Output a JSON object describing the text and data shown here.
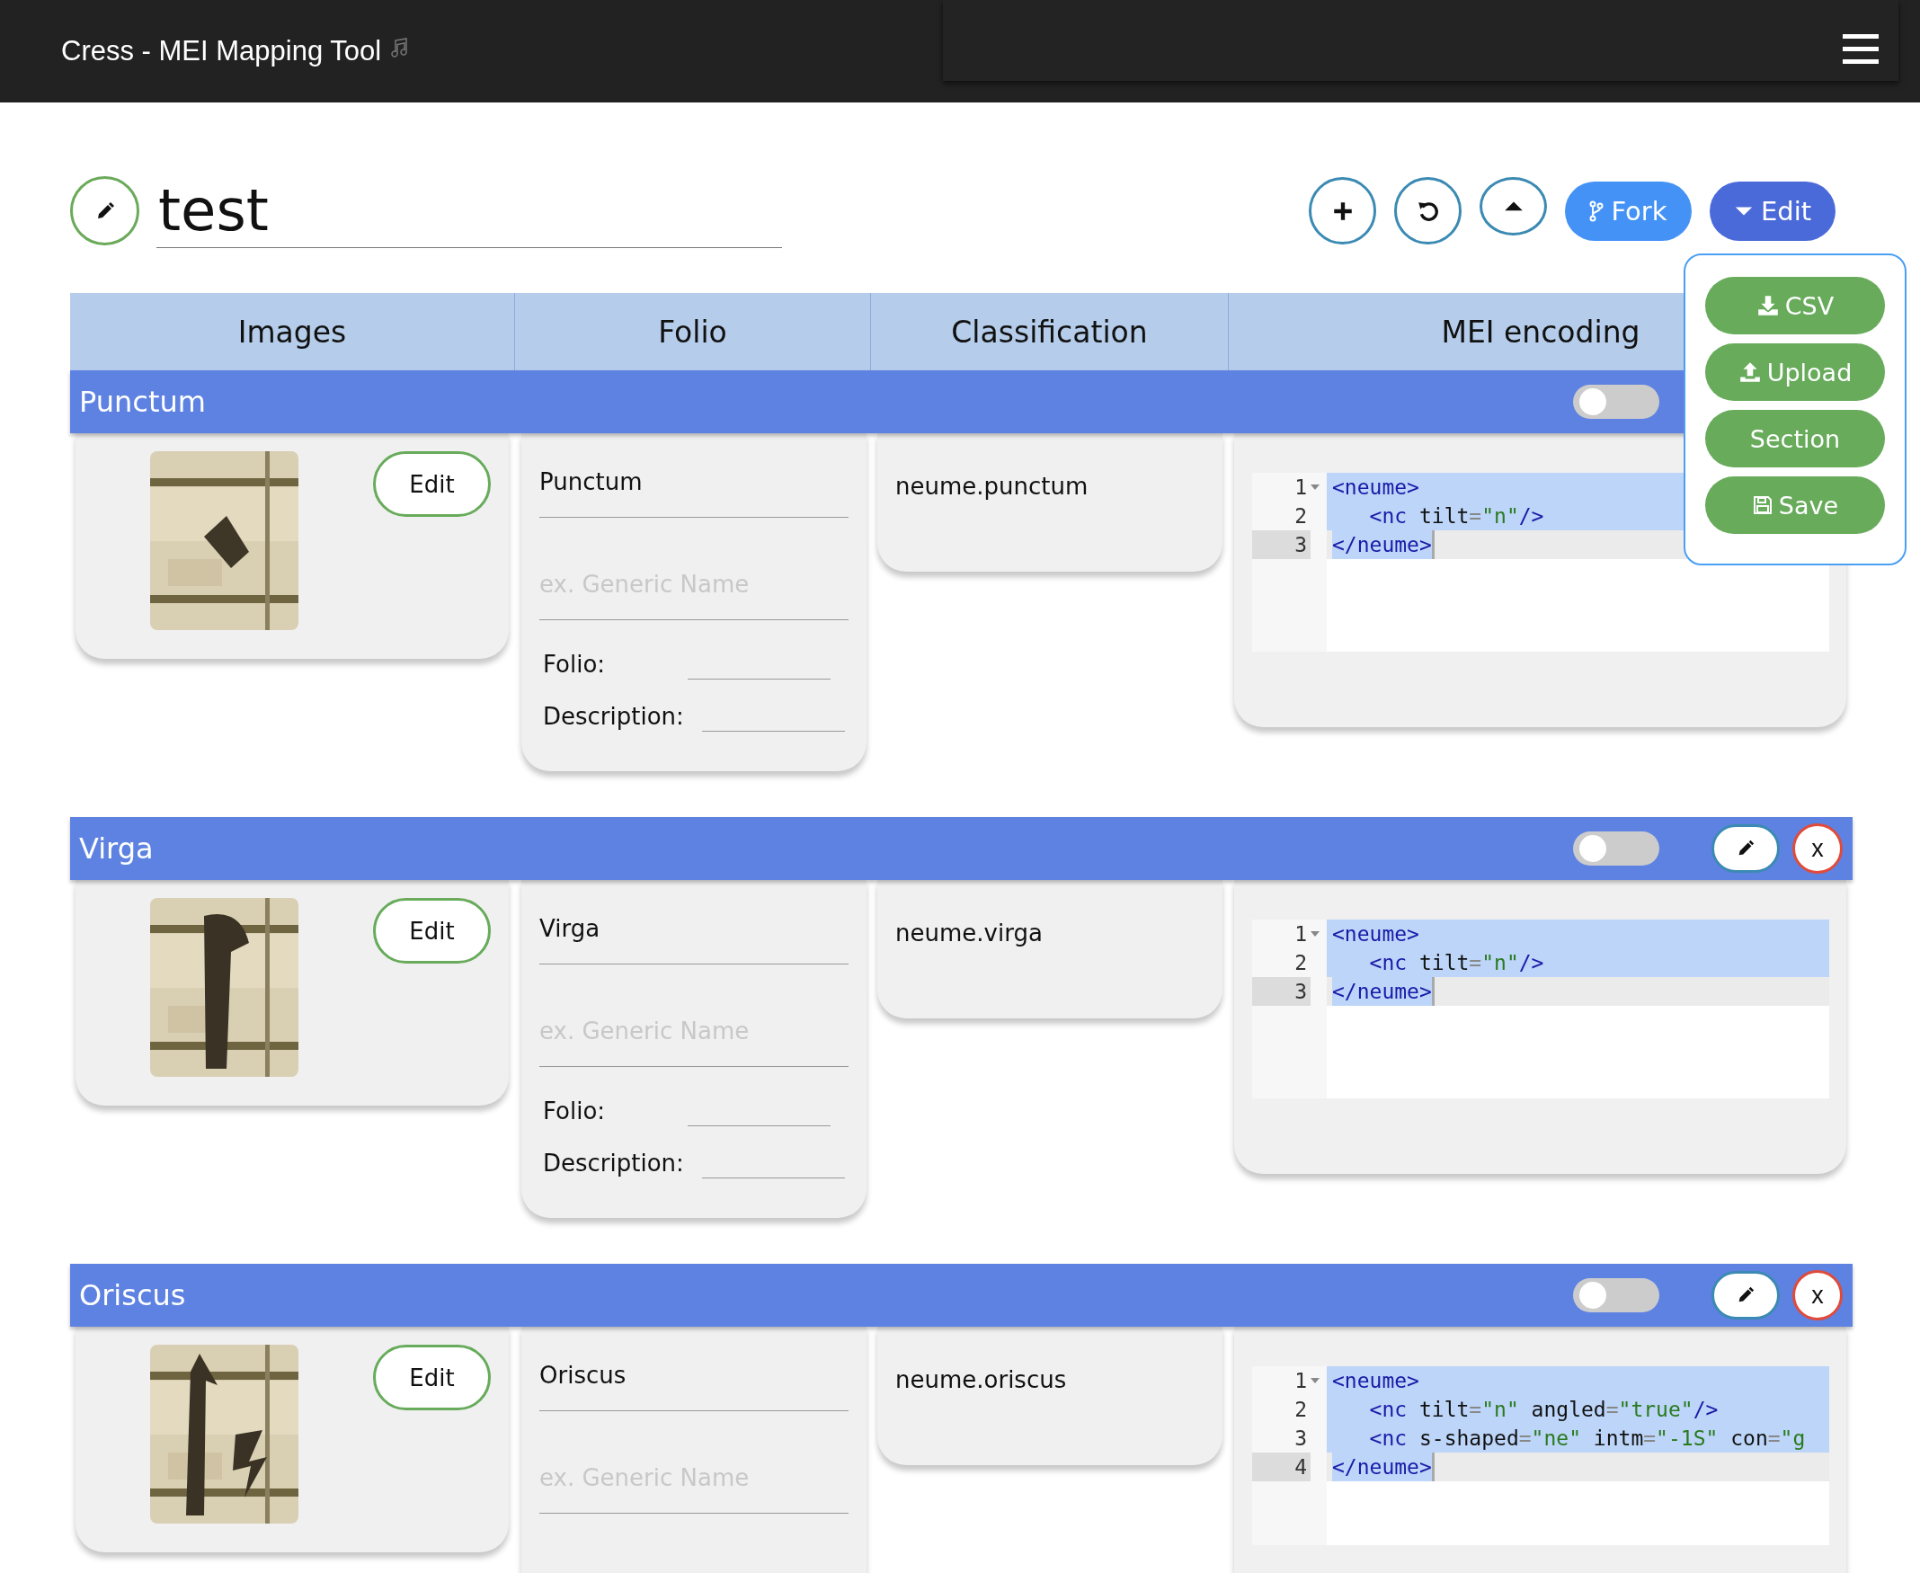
{
  "header": {
    "title": "Cress - MEI Mapping Tool"
  },
  "document": {
    "title": "test"
  },
  "toolbar": [
    {
      "kind": "add"
    },
    {
      "kind": "undo"
    },
    {
      "kind": "collapse"
    },
    {
      "kind": "fork",
      "label": "Fork"
    },
    {
      "kind": "edit",
      "label": "Edit"
    }
  ],
  "edit_menu": {
    "open": true,
    "items": [
      {
        "kind": "download",
        "label": "CSV"
      },
      {
        "kind": "upload",
        "label": "Upload"
      },
      {
        "kind": "plain",
        "label": "Section"
      },
      {
        "kind": "save",
        "label": "Save"
      }
    ]
  },
  "table": {
    "columns": [
      "Images",
      "Folio",
      "Classification",
      "MEI encoding"
    ],
    "sections": [
      {
        "title": "Punctum",
        "toggle": {
          "on": false
        },
        "image": {
          "kind": "picture"
        },
        "image_button": "Edit",
        "name": "Punctum",
        "generic_name_placeholder": "ex. Generic Name",
        "folio_label": "Folio:",
        "description_label": "Description:",
        "classification": "neume.punctum",
        "mei": [
          {
            "number": "1",
            "text": "<neume>",
            "selected": true,
            "active": false
          },
          {
            "number": "2",
            "text": "   <nc tilt=\"n\"/>",
            "selected": true,
            "active": false
          },
          {
            "number": "3",
            "text": "</neume>",
            "selected": true,
            "active": true
          }
        ]
      },
      {
        "title": "Virga",
        "toggle": {
          "on": false
        },
        "buttons": [
          {
            "kind": "edit"
          },
          {
            "kind": "delete",
            "label": "x"
          }
        ],
        "image": {
          "kind": "picture"
        },
        "image_button": "Edit",
        "name": "Virga",
        "generic_name_placeholder": "ex. Generic Name",
        "folio_label": "Folio:",
        "description_label": "Description:",
        "classification": "neume.virga",
        "mei": [
          {
            "number": "1",
            "text": "<neume>",
            "selected": true,
            "active": false
          },
          {
            "number": "2",
            "text": "   <nc tilt=\"n\"/>",
            "selected": true,
            "active": false
          },
          {
            "number": "3",
            "text": "</neume>",
            "selected": true,
            "active": true
          }
        ]
      },
      {
        "title": "Oriscus",
        "toggle": {
          "on": false
        },
        "buttons": [
          {
            "kind": "edit"
          },
          {
            "kind": "delete",
            "label": "x"
          }
        ],
        "image": {
          "kind": "picture"
        },
        "image_button": "Edit",
        "name": "Oriscus",
        "generic_name_placeholder": "ex. Generic Name",
        "classification": "neume.oriscus",
        "mei": [
          {
            "number": "1",
            "text": "<neume>",
            "selected": true,
            "active": false
          },
          {
            "number": "2",
            "text": "   <nc tilt=\"n\" angled=\"true\"/>",
            "selected": true,
            "active": false
          },
          {
            "number": "3",
            "text": "   <nc s-shaped=\"ne\" intm=\"-1S\" con=\"g",
            "selected": true,
            "active": false
          },
          {
            "number": "4",
            "text": "</neume>",
            "selected": true,
            "active": true
          }
        ]
      }
    ]
  }
}
